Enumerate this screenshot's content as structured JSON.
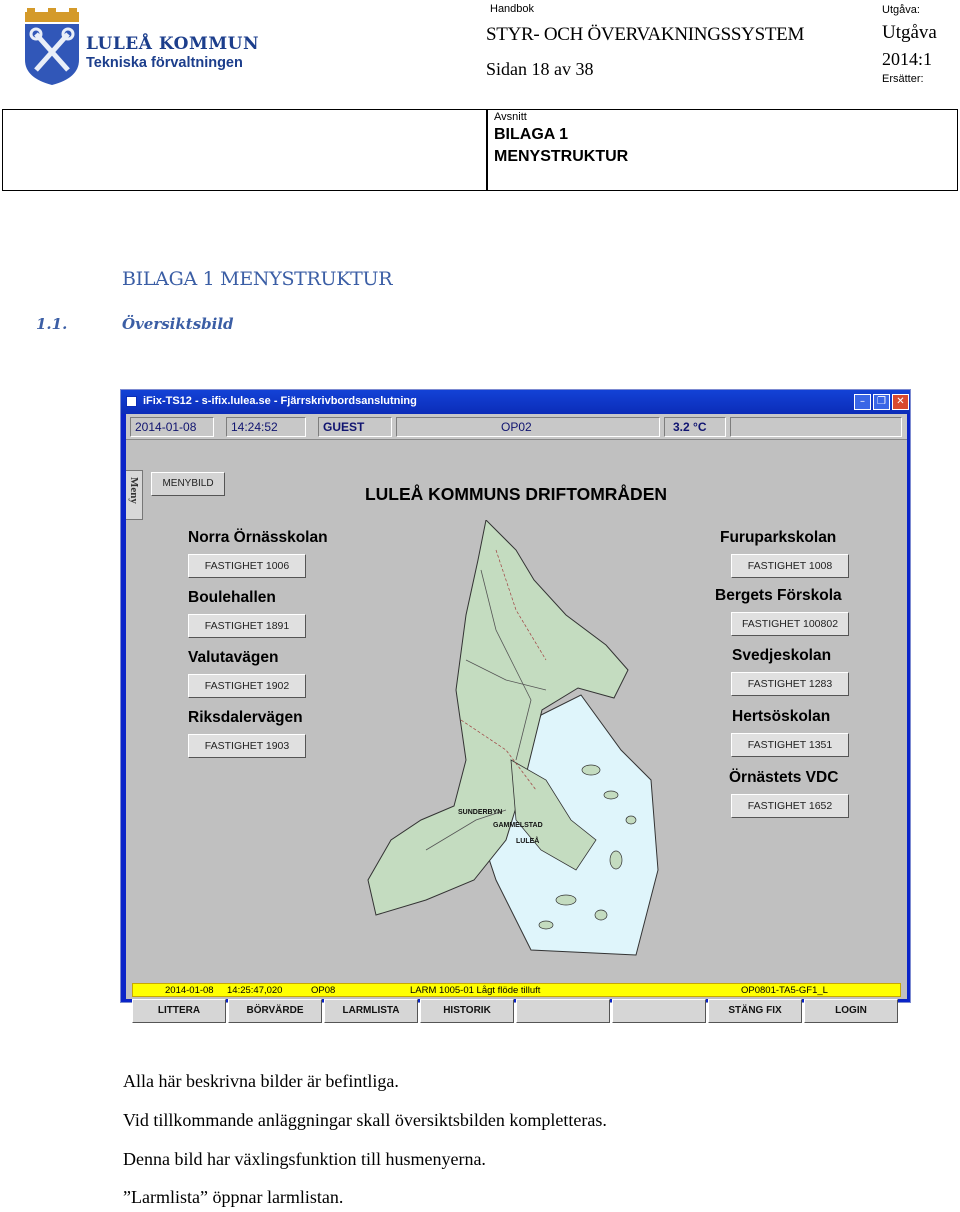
{
  "header": {
    "org_name": "LULEÅ KOMMUN",
    "org_sub": "Tekniska förvaltningen",
    "handbook_label": "Handbok",
    "handbook_title": "STYR- OCH ÖVERVAKNINGSSYSTEM",
    "page_text": "Sidan 18 av 38",
    "edition_label": "Utgåva:",
    "edition_value_1": "Utgåva",
    "edition_value_2": "2014:1",
    "replaces_label": "Ersätter:",
    "section_label": "Avsnitt",
    "section_line1": "BILAGA 1",
    "section_line2": "MENYSTRUKTUR"
  },
  "document": {
    "heading": "BILAGA 1 MENYSTRUKTUR",
    "subheading_number": "1.1.",
    "subheading_title": "Översiktsbild"
  },
  "app": {
    "window_title": "iFix-TS12 - s-ifix.lulea.se - Fjärrskrivbordsanslutning",
    "status": {
      "date": "2014-01-08",
      "time": "14:24:52",
      "user": "GUEST",
      "node": "OP02",
      "temperature": "3.2 °C"
    },
    "menu_tab": "Meny",
    "menybild_button": "MENYBILD",
    "title": "LULEÅ KOMMUNS DRIFTOMRÅDEN",
    "sites_left": [
      {
        "name": "Norra Örnässkolan",
        "button": "FASTIGHET 1006"
      },
      {
        "name": "Boulehallen",
        "button": "FASTIGHET 1891"
      },
      {
        "name": "Valutavägen",
        "button": "FASTIGHET 1902"
      },
      {
        "name": "Riksdalervägen",
        "button": "FASTIGHET 1903"
      }
    ],
    "sites_right": [
      {
        "name": "Furuparkskolan",
        "button": "FASTIGHET 1008"
      },
      {
        "name": "Bergets Förskola",
        "button": "FASTIGHET 100802"
      },
      {
        "name": "Svedjeskolan",
        "button": "FASTIGHET 1283"
      },
      {
        "name": "Hertsöskolan",
        "button": "FASTIGHET 1351"
      },
      {
        "name": "Örnästets VDC",
        "button": "FASTIGHET 1652"
      }
    ],
    "map_labels": {
      "sunderby": "SUNDERBYN",
      "gammelstad": "GAMMELSTAD",
      "lulea": "LULEÅ"
    },
    "alarm": {
      "date": "2014-01-08",
      "time": "14:25:47,020",
      "node": "OP08",
      "message": "LARM  1005-01 Lågt flöde tilluft",
      "tag": "OP0801-TA5-GF1_L"
    },
    "function_keys": [
      "LITTERA",
      "BÖRVÄRDE",
      "LARMLISTA",
      "HISTORIK",
      "",
      "",
      "STÄNG FIX",
      "LOGIN"
    ]
  },
  "body_text": [
    "Alla här beskrivna bilder är befintliga.",
    "Vid tillkommande anläggningar skall översiktsbilden kompletteras.",
    "Denna bild har växlingsfunktion till husmenyerna.",
    "”Larmlista” öppnar larmlistan."
  ],
  "colors": {
    "brand_blue": "#1c3e8c",
    "heading_blue": "#3b5ea5",
    "titlebar_blue": "#0b2cb8",
    "alarm_yellow": "#ffff00",
    "map_land": "#c4dcc0",
    "map_water": "#dff5fb"
  }
}
